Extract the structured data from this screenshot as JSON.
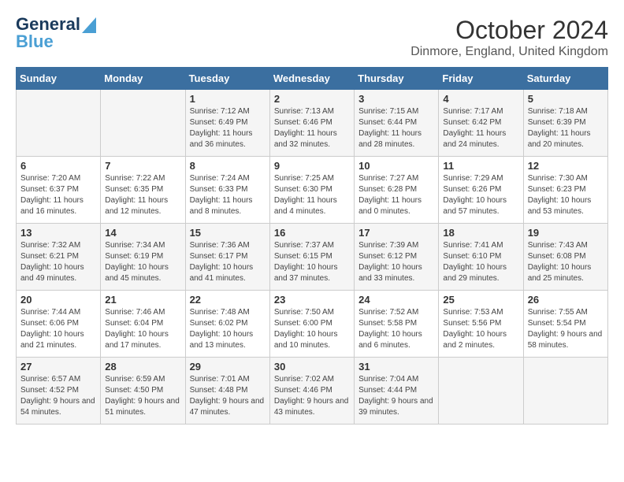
{
  "logo": {
    "line1": "General",
    "line2": "Blue"
  },
  "title": "October 2024",
  "location": "Dinmore, England, United Kingdom",
  "weekdays": [
    "Sunday",
    "Monday",
    "Tuesday",
    "Wednesday",
    "Thursday",
    "Friday",
    "Saturday"
  ],
  "weeks": [
    [
      {
        "day": "",
        "info": ""
      },
      {
        "day": "",
        "info": ""
      },
      {
        "day": "1",
        "info": "Sunrise: 7:12 AM\nSunset: 6:49 PM\nDaylight: 11 hours and 36 minutes."
      },
      {
        "day": "2",
        "info": "Sunrise: 7:13 AM\nSunset: 6:46 PM\nDaylight: 11 hours and 32 minutes."
      },
      {
        "day": "3",
        "info": "Sunrise: 7:15 AM\nSunset: 6:44 PM\nDaylight: 11 hours and 28 minutes."
      },
      {
        "day": "4",
        "info": "Sunrise: 7:17 AM\nSunset: 6:42 PM\nDaylight: 11 hours and 24 minutes."
      },
      {
        "day": "5",
        "info": "Sunrise: 7:18 AM\nSunset: 6:39 PM\nDaylight: 11 hours and 20 minutes."
      }
    ],
    [
      {
        "day": "6",
        "info": "Sunrise: 7:20 AM\nSunset: 6:37 PM\nDaylight: 11 hours and 16 minutes."
      },
      {
        "day": "7",
        "info": "Sunrise: 7:22 AM\nSunset: 6:35 PM\nDaylight: 11 hours and 12 minutes."
      },
      {
        "day": "8",
        "info": "Sunrise: 7:24 AM\nSunset: 6:33 PM\nDaylight: 11 hours and 8 minutes."
      },
      {
        "day": "9",
        "info": "Sunrise: 7:25 AM\nSunset: 6:30 PM\nDaylight: 11 hours and 4 minutes."
      },
      {
        "day": "10",
        "info": "Sunrise: 7:27 AM\nSunset: 6:28 PM\nDaylight: 11 hours and 0 minutes."
      },
      {
        "day": "11",
        "info": "Sunrise: 7:29 AM\nSunset: 6:26 PM\nDaylight: 10 hours and 57 minutes."
      },
      {
        "day": "12",
        "info": "Sunrise: 7:30 AM\nSunset: 6:23 PM\nDaylight: 10 hours and 53 minutes."
      }
    ],
    [
      {
        "day": "13",
        "info": "Sunrise: 7:32 AM\nSunset: 6:21 PM\nDaylight: 10 hours and 49 minutes."
      },
      {
        "day": "14",
        "info": "Sunrise: 7:34 AM\nSunset: 6:19 PM\nDaylight: 10 hours and 45 minutes."
      },
      {
        "day": "15",
        "info": "Sunrise: 7:36 AM\nSunset: 6:17 PM\nDaylight: 10 hours and 41 minutes."
      },
      {
        "day": "16",
        "info": "Sunrise: 7:37 AM\nSunset: 6:15 PM\nDaylight: 10 hours and 37 minutes."
      },
      {
        "day": "17",
        "info": "Sunrise: 7:39 AM\nSunset: 6:12 PM\nDaylight: 10 hours and 33 minutes."
      },
      {
        "day": "18",
        "info": "Sunrise: 7:41 AM\nSunset: 6:10 PM\nDaylight: 10 hours and 29 minutes."
      },
      {
        "day": "19",
        "info": "Sunrise: 7:43 AM\nSunset: 6:08 PM\nDaylight: 10 hours and 25 minutes."
      }
    ],
    [
      {
        "day": "20",
        "info": "Sunrise: 7:44 AM\nSunset: 6:06 PM\nDaylight: 10 hours and 21 minutes."
      },
      {
        "day": "21",
        "info": "Sunrise: 7:46 AM\nSunset: 6:04 PM\nDaylight: 10 hours and 17 minutes."
      },
      {
        "day": "22",
        "info": "Sunrise: 7:48 AM\nSunset: 6:02 PM\nDaylight: 10 hours and 13 minutes."
      },
      {
        "day": "23",
        "info": "Sunrise: 7:50 AM\nSunset: 6:00 PM\nDaylight: 10 hours and 10 minutes."
      },
      {
        "day": "24",
        "info": "Sunrise: 7:52 AM\nSunset: 5:58 PM\nDaylight: 10 hours and 6 minutes."
      },
      {
        "day": "25",
        "info": "Sunrise: 7:53 AM\nSunset: 5:56 PM\nDaylight: 10 hours and 2 minutes."
      },
      {
        "day": "26",
        "info": "Sunrise: 7:55 AM\nSunset: 5:54 PM\nDaylight: 9 hours and 58 minutes."
      }
    ],
    [
      {
        "day": "27",
        "info": "Sunrise: 6:57 AM\nSunset: 4:52 PM\nDaylight: 9 hours and 54 minutes."
      },
      {
        "day": "28",
        "info": "Sunrise: 6:59 AM\nSunset: 4:50 PM\nDaylight: 9 hours and 51 minutes."
      },
      {
        "day": "29",
        "info": "Sunrise: 7:01 AM\nSunset: 4:48 PM\nDaylight: 9 hours and 47 minutes."
      },
      {
        "day": "30",
        "info": "Sunrise: 7:02 AM\nSunset: 4:46 PM\nDaylight: 9 hours and 43 minutes."
      },
      {
        "day": "31",
        "info": "Sunrise: 7:04 AM\nSunset: 4:44 PM\nDaylight: 9 hours and 39 minutes."
      },
      {
        "day": "",
        "info": ""
      },
      {
        "day": "",
        "info": ""
      }
    ]
  ]
}
